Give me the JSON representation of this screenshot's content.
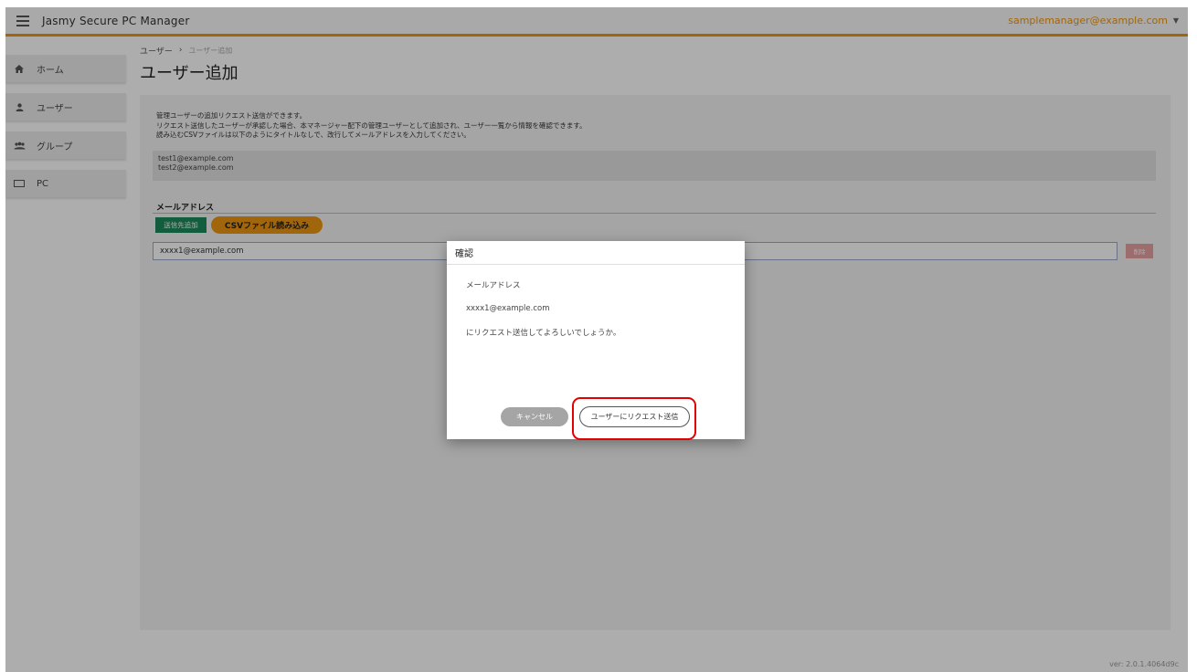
{
  "header": {
    "app_title": "Jasmy Secure PC Manager",
    "user_email": "samplemanager@example.com",
    "menu_icon": "hamburger-icon",
    "caret_icon": "caret-down-icon",
    "accent_color": "#ee9611"
  },
  "sidebar": {
    "items": [
      {
        "label": "ホーム",
        "icon": "home-icon"
      },
      {
        "label": "ユーザー",
        "icon": "user-icon"
      },
      {
        "label": "グループ",
        "icon": "group-icon"
      },
      {
        "label": "PC",
        "icon": "pc-icon"
      }
    ]
  },
  "breadcrumb": {
    "parent": "ユーザー",
    "separator": "›",
    "current": "ユーザー追加"
  },
  "page": {
    "title": "ユーザー追加",
    "description": [
      "管理ユーザーの追加リクエスト送信ができます。",
      "リクエスト送信したユーザーが承認した場合、本マネージャー配下の管理ユーザーとして追加され、ユーザー一覧から情報を確認できます。",
      "読み込むCSVファイルは以下のようにタイトルなしで、改行してメールアドレスを入力してください。"
    ],
    "sample_lines": [
      "test1@example.com",
      "test2@example.com"
    ],
    "section_title": "メールアドレス",
    "add_button": "送信先追加",
    "csv_button": "CSVファイル読み込み",
    "email_value": "xxxx1@example.com",
    "delete_button": "削除"
  },
  "modal": {
    "title": "確認",
    "label": "メールアドレス",
    "email": "xxxx1@example.com",
    "message": "にリクエスト送信してよろしいでしょうか。",
    "cancel_button": "キャンセル",
    "confirm_button": "ユーザーにリクエスト送信"
  },
  "footer": {
    "version": "ver: 2.0.1.4064d9c"
  }
}
